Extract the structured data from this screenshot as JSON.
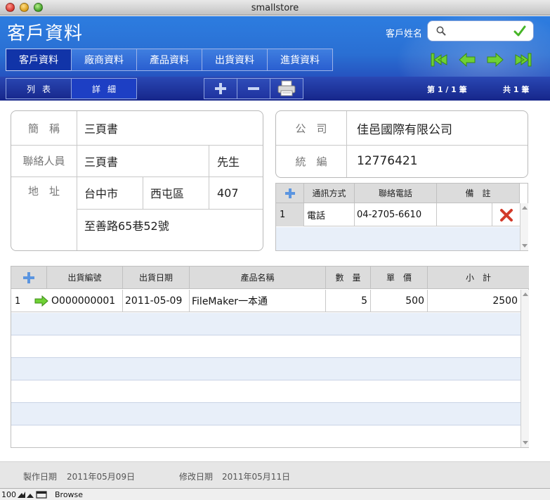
{
  "window": {
    "title": "smallstore"
  },
  "header": {
    "title": "客戶資料",
    "search_label": "客戶姓名",
    "search_value": ""
  },
  "tabs": [
    {
      "label": "客戶資料",
      "active": true
    },
    {
      "label": "廠商資料",
      "active": false
    },
    {
      "label": "產品資料",
      "active": false
    },
    {
      "label": "出貨資料",
      "active": false
    },
    {
      "label": "進貨資料",
      "active": false
    }
  ],
  "view_toggle": {
    "list": "列表",
    "detail": "詳細"
  },
  "record": {
    "position": "第 1 / 1 筆",
    "total": "共 1 筆"
  },
  "customer": {
    "labels": {
      "short_name": "簡　稱",
      "contact": "聯絡人員",
      "address": "地　址",
      "company": "公　司",
      "tax_id": "統　編"
    },
    "short_name": "三頁書",
    "contact_person": "三頁書",
    "title": "先生",
    "city": "台中市",
    "district": "西屯區",
    "zip": "407",
    "street": "至善路65巷52號",
    "company": "佳邑國際有限公司",
    "tax_id": "12776421"
  },
  "contacts": {
    "headers": [
      "通訊方式",
      "聯絡電話",
      "備　註"
    ],
    "rows": [
      {
        "index": "1",
        "method": "電話",
        "phone": "04-2705-6610",
        "note": ""
      }
    ]
  },
  "orders": {
    "headers": [
      "出貨編號",
      "出貨日期",
      "產品名稱",
      "數　量",
      "單　價",
      "小　計"
    ],
    "rows": [
      {
        "index": "1",
        "order_no": "O000000001",
        "date": "2011-05-09",
        "product": "FileMaker一本通",
        "qty": "5",
        "price": "500",
        "subtotal": "2500"
      }
    ]
  },
  "footer": {
    "created_label": "製作日期",
    "created_date": "2011年05月09日",
    "modified_label": "修改日期",
    "modified_date": "2011年05月11日"
  },
  "status": {
    "zoom": "100",
    "mode": "Browse"
  },
  "colors": {
    "header_blue": "#2a6fd3",
    "active_tab": "#1134a8",
    "nav_green": "#5fbe2b",
    "row_alt": "#e8eff9"
  }
}
